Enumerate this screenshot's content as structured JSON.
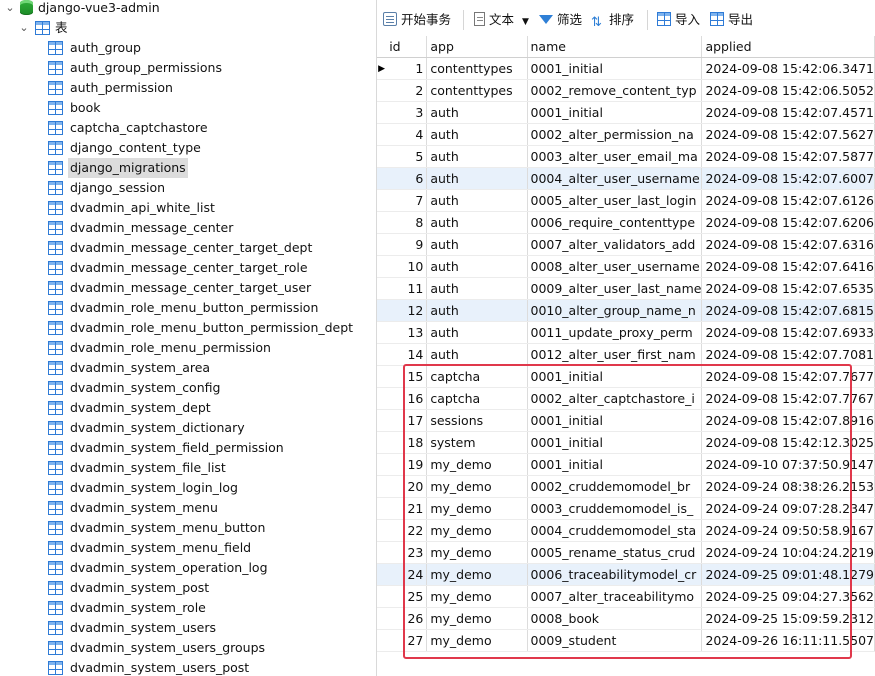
{
  "tree": {
    "root_label": "django-vue3-admin",
    "group_label": "表",
    "tables": [
      "auth_group",
      "auth_group_permissions",
      "auth_permission",
      "book",
      "captcha_captchastore",
      "django_content_type",
      "django_migrations",
      "django_session",
      "dvadmin_api_white_list",
      "dvadmin_message_center",
      "dvadmin_message_center_target_dept",
      "dvadmin_message_center_target_role",
      "dvadmin_message_center_target_user",
      "dvadmin_role_menu_button_permission",
      "dvadmin_role_menu_button_permission_dept",
      "dvadmin_role_menu_permission",
      "dvadmin_system_area",
      "dvadmin_system_config",
      "dvadmin_system_dept",
      "dvadmin_system_dictionary",
      "dvadmin_system_field_permission",
      "dvadmin_system_file_list",
      "dvadmin_system_login_log",
      "dvadmin_system_menu",
      "dvadmin_system_menu_button",
      "dvadmin_system_menu_field",
      "dvadmin_system_operation_log",
      "dvadmin_system_post",
      "dvadmin_system_role",
      "dvadmin_system_users",
      "dvadmin_system_users_groups",
      "dvadmin_system_users_post"
    ],
    "selected": "django_migrations"
  },
  "toolbar": {
    "begin_transaction": "开始事务",
    "text": "文本",
    "filter": "筛选",
    "sort": "排序",
    "import": "导入",
    "export": "导出"
  },
  "grid": {
    "columns": [
      "id",
      "app",
      "name",
      "applied"
    ],
    "rows": [
      [
        "1",
        "contenttypes",
        "0001_initial",
        "2024-09-08 15:42:06.3471"
      ],
      [
        "2",
        "contenttypes",
        "0002_remove_content_typ",
        "2024-09-08 15:42:06.5052"
      ],
      [
        "3",
        "auth",
        "0001_initial",
        "2024-09-08 15:42:07.4571"
      ],
      [
        "4",
        "auth",
        "0002_alter_permission_na",
        "2024-09-08 15:42:07.5627"
      ],
      [
        "5",
        "auth",
        "0003_alter_user_email_ma",
        "2024-09-08 15:42:07.5877"
      ],
      [
        "6",
        "auth",
        "0004_alter_user_username",
        "2024-09-08 15:42:07.6007"
      ],
      [
        "7",
        "auth",
        "0005_alter_user_last_login",
        "2024-09-08 15:42:07.6126"
      ],
      [
        "8",
        "auth",
        "0006_require_contenttype",
        "2024-09-08 15:42:07.6206"
      ],
      [
        "9",
        "auth",
        "0007_alter_validators_add",
        "2024-09-08 15:42:07.6316"
      ],
      [
        "10",
        "auth",
        "0008_alter_user_username",
        "2024-09-08 15:42:07.6416"
      ],
      [
        "11",
        "auth",
        "0009_alter_user_last_name",
        "2024-09-08 15:42:07.6535"
      ],
      [
        "12",
        "auth",
        "0010_alter_group_name_n",
        "2024-09-08 15:42:07.6815"
      ],
      [
        "13",
        "auth",
        "0011_update_proxy_perm",
        "2024-09-08 15:42:07.6933"
      ],
      [
        "14",
        "auth",
        "0012_alter_user_first_nam",
        "2024-09-08 15:42:07.7081"
      ],
      [
        "15",
        "captcha",
        "0001_initial",
        "2024-09-08 15:42:07.7677"
      ],
      [
        "16",
        "captcha",
        "0002_alter_captchastore_i",
        "2024-09-08 15:42:07.7767"
      ],
      [
        "17",
        "sessions",
        "0001_initial",
        "2024-09-08 15:42:07.8916"
      ],
      [
        "18",
        "system",
        "0001_initial",
        "2024-09-08 15:42:12.3025"
      ],
      [
        "19",
        "my_demo",
        "0001_initial",
        "2024-09-10 07:37:50.9147"
      ],
      [
        "20",
        "my_demo",
        "0002_cruddemomodel_br",
        "2024-09-24 08:38:26.2153"
      ],
      [
        "21",
        "my_demo",
        "0003_cruddemomodel_is_",
        "2024-09-24 09:07:28.2347"
      ],
      [
        "22",
        "my_demo",
        "0004_cruddemomodel_sta",
        "2024-09-24 09:50:58.9167"
      ],
      [
        "23",
        "my_demo",
        "0005_rename_status_crud",
        "2024-09-24 10:04:24.2219"
      ],
      [
        "24",
        "my_demo",
        "0006_traceabilitymodel_cr",
        "2024-09-25 09:01:48.1279"
      ],
      [
        "25",
        "my_demo",
        "0007_alter_traceabilitymo",
        "2024-09-25 09:04:27.3562"
      ],
      [
        "26",
        "my_demo",
        "0008_book",
        "2024-09-25 15:09:59.2312"
      ],
      [
        "27",
        "my_demo",
        "0009_student",
        "2024-09-26 16:11:11.5507"
      ]
    ],
    "current_row_marker": "▶",
    "highlight_color": "#e0384b"
  }
}
